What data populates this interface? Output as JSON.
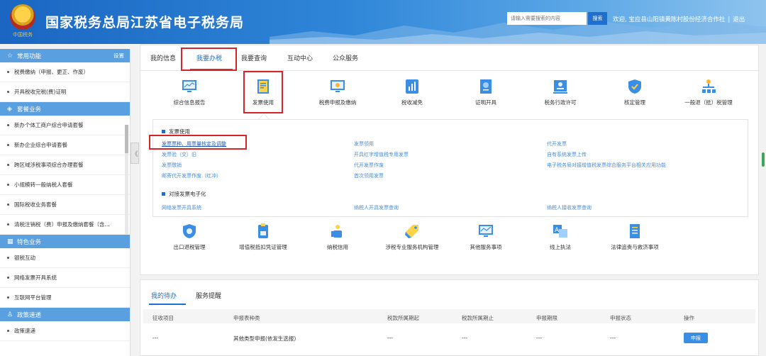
{
  "header": {
    "emblem_text": "中国税务",
    "title": "国家税务总局江苏省电子税务局",
    "search_placeholder": "请输入需要搜索的内容",
    "search_button": "搜索",
    "welcome": "欢迎, 宝应县山阳镇黄陈村股份经济合作社",
    "separator": "|",
    "logout": "退出"
  },
  "sidebar": {
    "sections": [
      {
        "title": "常用功能",
        "icon": "star-icon",
        "setting": "设置",
        "items": [
          "税费缴纳（申报、更正、作废）",
          "开具税收完税(费)证明"
        ]
      },
      {
        "title": "套餐业务",
        "icon": "layers-icon",
        "items": [
          "新办个体工商户综合申请套餐",
          "新办企业综合申请套餐",
          "跨区域涉税事项综合办理套餐",
          "小规模转一般纳税人套餐",
          "国际税收业务套餐",
          "清税注销税（费）申报及缴纳套餐（含..."
        ]
      },
      {
        "title": "特色业务",
        "icon": "grid-icon",
        "items": [
          "银税互动",
          "网络发票开具系统",
          "互联网平台管理"
        ]
      },
      {
        "title": "政策速递",
        "icon": "person-icon",
        "items": [
          "政策速递"
        ]
      }
    ]
  },
  "collapse_glyph": "《",
  "main": {
    "tabs": [
      "我的信息",
      "我要办税",
      "我要查询",
      "互动中心",
      "公众服务"
    ],
    "active_tab": "我要办税",
    "top_grid": [
      "综合信息报告",
      "发票使用",
      "税费申报及缴纳",
      "税收减免",
      "证明开具",
      "税务行政许可",
      "核定管理",
      "一般退（抵）税管理"
    ],
    "invoice_section": {
      "title": "发票使用",
      "links": [
        "发票票种、用票量核定及调整",
        "发票领用",
        "代开发票",
        "发票验（交）旧",
        "开具红字增值税专用发票",
        "自有系统发票上传",
        "发票缴销",
        "代开发票作废",
        "电子税务局对接增值税发票综合服务平台相关应用功能",
        "邮寄代开发票作废（红冲）",
        "首次领用发票"
      ]
    },
    "electronic_section": {
      "title": "对接发票电子化",
      "links": [
        "网络发票开具系统",
        "纳税人开具发票查询",
        "纳税人接收发票查询"
      ]
    },
    "bottom_grid": [
      "出口退税管理",
      "增值税抵扣凭证管理",
      "纳税信用",
      "涉税专业服务机构管理",
      "其他服务事项",
      "线上执法",
      "法律追责与救济事项"
    ]
  },
  "todo": {
    "tabs": [
      "我的待办",
      "服务提醒"
    ],
    "columns": [
      "征收项目",
      "申报表种类",
      "税款所属期起",
      "税款所属期止",
      "申报期限",
      "申报状态",
      "操作"
    ],
    "row": [
      "---",
      "其他类型申报(依发生选报)",
      "---",
      "---",
      "---",
      "---"
    ],
    "action": "申报"
  },
  "colors": {
    "brand_blue": "#1f6fd1",
    "highlight_red": "#d7242a",
    "sidebar_blue": "#5a9fe0"
  }
}
